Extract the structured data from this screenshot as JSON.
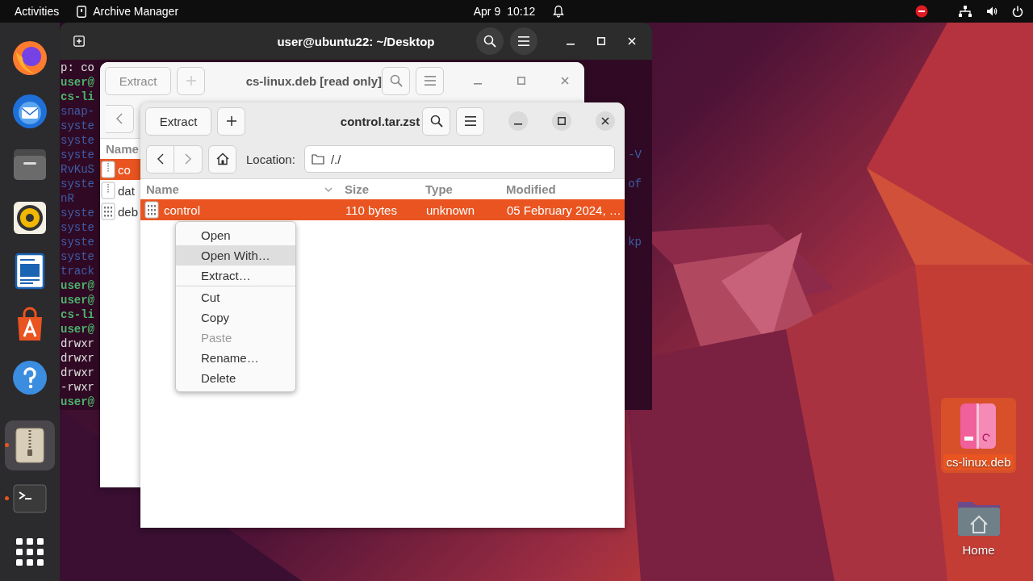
{
  "top_bar": {
    "activities": "Activities",
    "app_name": "Archive Manager",
    "date": "Apr 9",
    "time": "10:12"
  },
  "dock": {
    "items": [
      {
        "kind": "browser",
        "running": false,
        "selected": false
      },
      {
        "kind": "mail",
        "running": false,
        "selected": false
      },
      {
        "kind": "files",
        "running": false,
        "selected": false
      },
      {
        "kind": "music",
        "running": false,
        "selected": false
      },
      {
        "kind": "writer",
        "running": false,
        "selected": false
      },
      {
        "kind": "store",
        "running": false,
        "selected": false
      },
      {
        "kind": "help",
        "running": false,
        "selected": false
      },
      {
        "kind": "archive",
        "running": true,
        "selected": true
      },
      {
        "kind": "terminal",
        "running": true,
        "selected": false
      },
      {
        "kind": "apps",
        "running": false,
        "selected": false
      }
    ]
  },
  "terminal": {
    "title": "user@ubuntu22: ~/Desktop",
    "lines": [
      {
        "kind": "plain",
        "left": "p: co"
      },
      {
        "kind": "prompt",
        "left": "user@"
      },
      {
        "kind": "exec",
        "left": "cs-li"
      },
      {
        "kind": "info",
        "left": "snap-"
      },
      {
        "kind": "info",
        "left": "syste"
      },
      {
        "kind": "info",
        "left": "syste"
      },
      {
        "kind": "info",
        "left": "syste",
        "right": "-V"
      },
      {
        "kind": "info",
        "left": "RvKuS"
      },
      {
        "kind": "info",
        "left": "syste",
        "right": "of"
      },
      {
        "kind": "info",
        "left": "nR"
      },
      {
        "kind": "info",
        "left": "syste"
      },
      {
        "kind": "info",
        "left": "syste"
      },
      {
        "kind": "info",
        "left": "syste",
        "right": "kp"
      },
      {
        "kind": "info",
        "left": "syste"
      },
      {
        "kind": "info",
        "left": "track"
      },
      {
        "kind": "prompt",
        "left": "user@"
      },
      {
        "kind": "prompt",
        "left": "user@"
      },
      {
        "kind": "exec",
        "left": "cs-li"
      },
      {
        "kind": "prompt",
        "left": "user@"
      },
      {
        "kind": "plain",
        "left": "drwxr"
      },
      {
        "kind": "plain",
        "left": "drwxr"
      },
      {
        "kind": "plain",
        "left": "drwxr"
      },
      {
        "kind": "plain",
        "left": "-rwxr"
      },
      {
        "kind": "prompt",
        "left": "user@"
      }
    ]
  },
  "archive_windows": [
    {
      "title": "cs-linux.deb [read only]",
      "active": false,
      "extract": "Extract",
      "add_disabled": true,
      "columns": [
        {
          "label": "Name",
          "sorted": false
        }
      ],
      "rows": [
        {
          "kind": "archive",
          "selected": true,
          "cells": [
            "co"
          ]
        },
        {
          "kind": "archive",
          "selected": false,
          "cells": [
            "dat"
          ]
        },
        {
          "kind": "binary",
          "selected": false,
          "cells": [
            "deb"
          ]
        }
      ]
    },
    {
      "title": "control.tar.zst",
      "active": true,
      "extract": "Extract",
      "add_disabled": false,
      "location_label": "Location:",
      "location": "/./",
      "columns": [
        {
          "label": "Name",
          "sorted": true
        },
        {
          "label": "Size",
          "sorted": false
        },
        {
          "label": "Type",
          "sorted": false
        },
        {
          "label": "Modified",
          "sorted": false
        }
      ],
      "rows": [
        {
          "kind": "binary",
          "selected": true,
          "cells": [
            "control",
            "110 bytes",
            "unknown",
            "05 February 2024, …"
          ]
        }
      ]
    }
  ],
  "context_menu": {
    "items": [
      {
        "kind": "item",
        "label": "Open",
        "highlighted": false,
        "disabled": false
      },
      {
        "kind": "item",
        "label": "Open With…",
        "highlighted": true,
        "disabled": false
      },
      {
        "kind": "item",
        "label": "Extract…",
        "highlighted": false,
        "disabled": false
      },
      {
        "kind": "separator"
      },
      {
        "kind": "item",
        "label": "Cut",
        "highlighted": false,
        "disabled": false
      },
      {
        "kind": "item",
        "label": "Copy",
        "highlighted": false,
        "disabled": false
      },
      {
        "kind": "item",
        "label": "Paste",
        "highlighted": false,
        "disabled": true
      },
      {
        "kind": "item",
        "label": "Rename…",
        "highlighted": false,
        "disabled": false
      },
      {
        "kind": "item",
        "label": "Delete",
        "highlighted": false,
        "disabled": false
      }
    ]
  },
  "desktop_icons": [
    {
      "kind": "package",
      "label": "cs-linux.deb",
      "selected": true
    },
    {
      "kind": "home",
      "label": "Home",
      "selected": false
    }
  ]
}
